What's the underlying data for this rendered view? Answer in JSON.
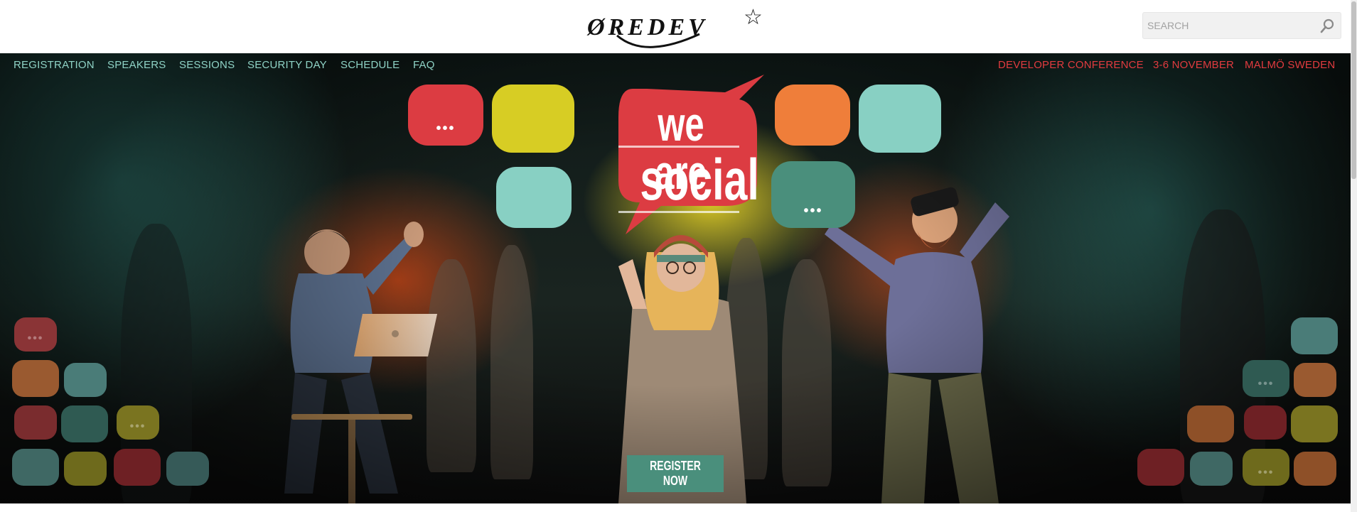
{
  "header": {
    "logo_text": "ØREDEV",
    "search": {
      "placeholder": "SEARCH",
      "value": ""
    }
  },
  "nav": {
    "items": [
      {
        "label": "REGISTRATION"
      },
      {
        "label": "SPEAKERS"
      },
      {
        "label": "SESSIONS"
      },
      {
        "label": "SECURITY DAY"
      },
      {
        "label": "SCHEDULE"
      },
      {
        "label": "FAQ"
      }
    ],
    "event_info": [
      "DEVELOPER CONFERENCE",
      "3-6 NOVEMBER",
      "MALMÖ SWEDEN"
    ]
  },
  "hero": {
    "headline_line1": "we are",
    "headline_line2": "social",
    "bubble_dots": "•••",
    "register_label": "REGISTER NOW"
  },
  "colors": {
    "nav_link": "#8fd3c6",
    "event_info": "#e23b3f",
    "bubble_red": "#dc3c42",
    "bubble_yellow": "#d7cd24",
    "bubble_orange": "#ef7e3a",
    "bubble_teal": "#88d0c3",
    "bubble_green": "#4a8f7c",
    "register_button": "#4a8f7c"
  },
  "icons": [
    "star-icon",
    "search-icon",
    "laptop-icon"
  ]
}
